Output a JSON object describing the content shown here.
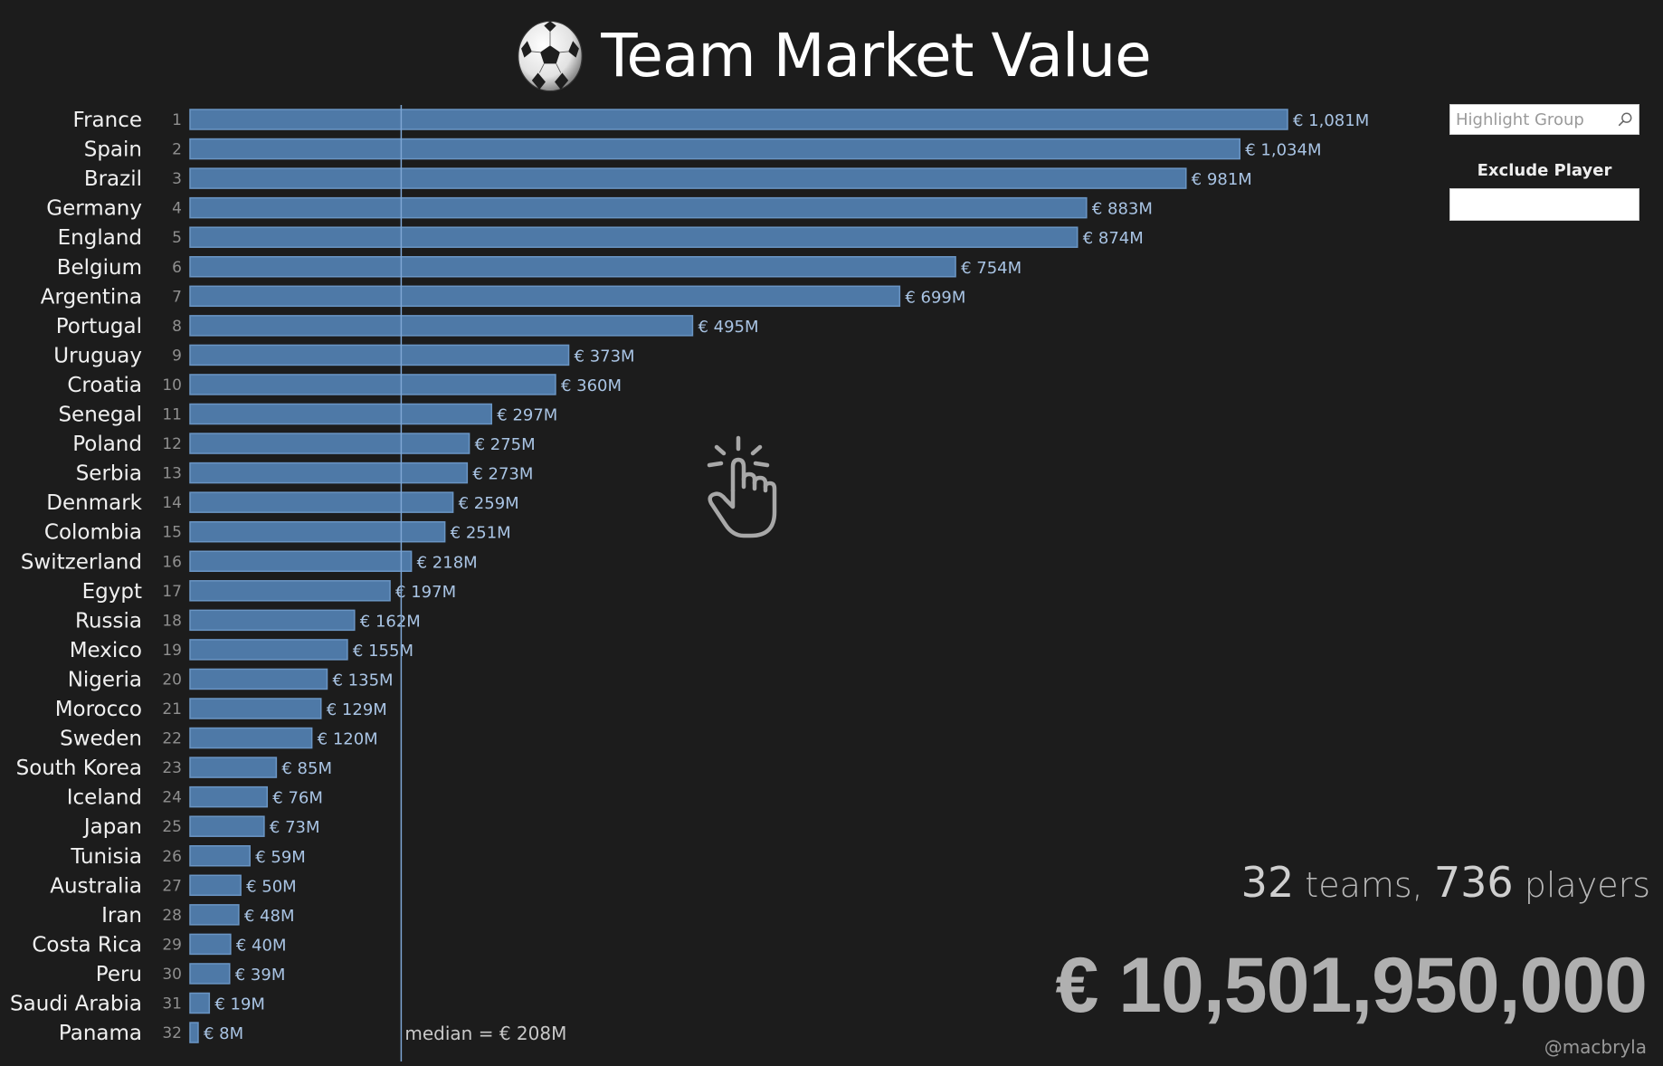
{
  "header": {
    "title": "Team Market Value",
    "title_icon": "soccer-ball-icon"
  },
  "controls": {
    "highlight_placeholder": "Highlight Group",
    "highlight_value": "",
    "search_icon": "search-icon",
    "exclude_label": "Exclude Player",
    "exclude_value": ""
  },
  "hint": {
    "icon": "tap-hand-icon"
  },
  "summary": {
    "teams_count": "32",
    "teams_label": " teams, ",
    "players_count": "736",
    "players_label": " players",
    "total_value": "€ 10,501,950,000",
    "credit": "@macbryla"
  },
  "colors": {
    "background": "#1c1c1c",
    "bar_fill": "#4e79a7",
    "bar_stroke": "#6a95c4",
    "median_line": "#7ea6d4",
    "value_label": "#a9c4e4"
  },
  "chart_data": {
    "type": "bar",
    "orientation": "horizontal",
    "title": "Team Market Value",
    "xlabel": "",
    "ylabel": "",
    "unit": "€ M",
    "value_prefix": "€ ",
    "value_suffix": "M",
    "grid": false,
    "categories": [
      "France",
      "Spain",
      "Brazil",
      "Germany",
      "England",
      "Belgium",
      "Argentina",
      "Portugal",
      "Uruguay",
      "Croatia",
      "Senegal",
      "Poland",
      "Serbia",
      "Denmark",
      "Colombia",
      "Switzerland",
      "Egypt",
      "Russia",
      "Mexico",
      "Nigeria",
      "Morocco",
      "Sweden",
      "South Korea",
      "Iceland",
      "Japan",
      "Tunisia",
      "Australia",
      "Iran",
      "Costa Rica",
      "Peru",
      "Saudi Arabia",
      "Panama"
    ],
    "ranks": [
      1,
      2,
      3,
      4,
      5,
      6,
      7,
      8,
      9,
      10,
      11,
      12,
      13,
      14,
      15,
      16,
      17,
      18,
      19,
      20,
      21,
      22,
      23,
      24,
      25,
      26,
      27,
      28,
      29,
      30,
      31,
      32
    ],
    "values": [
      1081,
      1034,
      981,
      883,
      874,
      754,
      699,
      495,
      373,
      360,
      297,
      275,
      273,
      259,
      251,
      218,
      197,
      162,
      155,
      135,
      129,
      120,
      85,
      76,
      73,
      59,
      50,
      48,
      40,
      39,
      19,
      8
    ],
    "value_labels": [
      "€ 1,081M",
      "€ 1,034M",
      "€ 981M",
      "€ 883M",
      "€ 874M",
      "€ 754M",
      "€ 699M",
      "€ 495M",
      "€ 373M",
      "€ 360M",
      "€ 297M",
      "€ 275M",
      "€ 273M",
      "€ 259M",
      "€ 251M",
      "€ 218M",
      "€ 197M",
      "€ 162M",
      "€ 155M",
      "€ 135M",
      "€ 129M",
      "€ 120M",
      "€ 85M",
      "€ 76M",
      "€ 73M",
      "€ 59M",
      "€ 50M",
      "€ 48M",
      "€ 40M",
      "€ 39M",
      "€ 19M",
      "€ 8M"
    ],
    "xlim": [
      0,
      1081
    ],
    "reference_line": {
      "type": "median",
      "value": 208,
      "label": "median = € 208M"
    }
  }
}
